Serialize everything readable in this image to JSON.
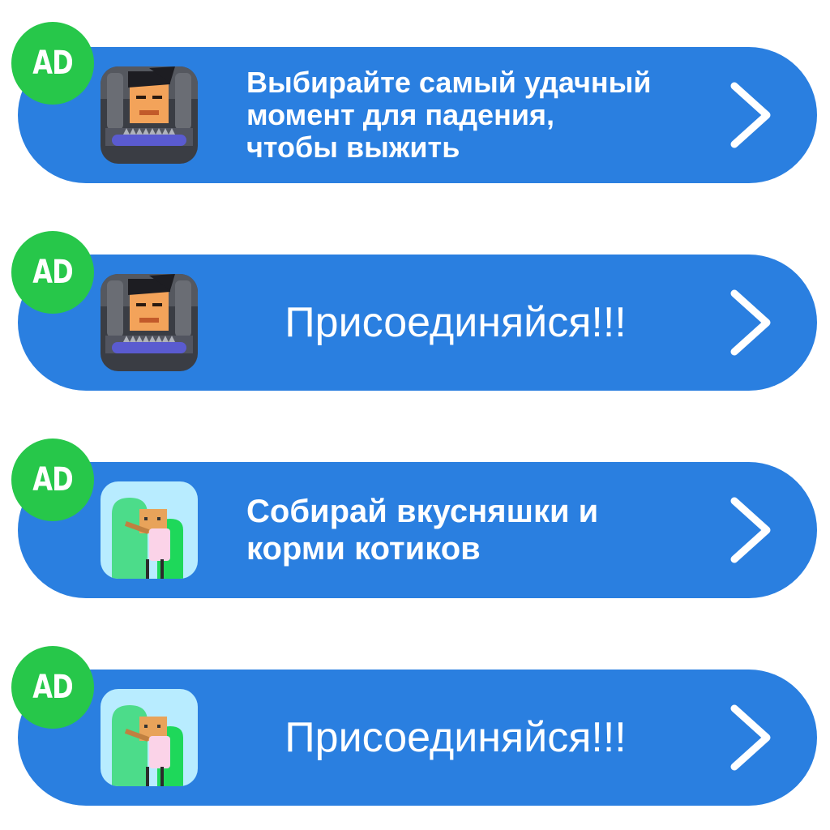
{
  "badge_label": "AD",
  "colors": {
    "banner": "#2a7fe0",
    "badge": "#27c74a",
    "text": "#ffffff"
  },
  "ads": [
    {
      "icon": "face-game-icon",
      "text": "Выбирайте самый удачный\nмомент для падения,\nчтобы выжить"
    },
    {
      "icon": "face-game-icon",
      "text": "Присоединяйся!!!"
    },
    {
      "icon": "cat-game-icon",
      "text": "Собирай вкусняшки и\nкорми котиков"
    },
    {
      "icon": "cat-game-icon",
      "text": "Присоединяйся!!!"
    }
  ]
}
